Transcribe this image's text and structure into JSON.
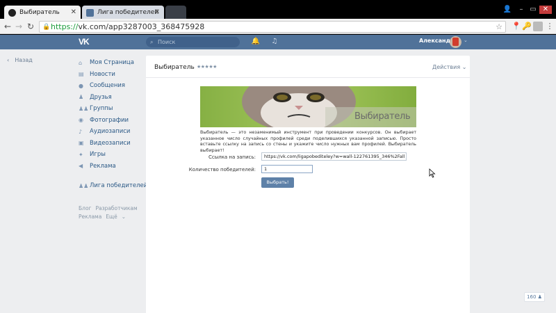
{
  "browser": {
    "tabs": [
      {
        "label": "Выбиратель",
        "active": true
      },
      {
        "label": "Лига победителей",
        "active": false
      }
    ],
    "url_scheme": "https://",
    "url_rest": "vk.com/app3287003_368475928",
    "window_controls": [
      "–",
      "▭",
      "✕"
    ]
  },
  "header": {
    "search_placeholder": "Поиск",
    "user_name": "Александр",
    "icons": [
      "bell-icon",
      "music-icon"
    ],
    "brand_color": "#507299"
  },
  "back_link": "Назад",
  "menu": {
    "items": [
      {
        "label": "Моя Страница",
        "icon": "home-icon"
      },
      {
        "label": "Новости",
        "icon": "news-icon"
      },
      {
        "label": "Сообщения",
        "icon": "messages-icon"
      },
      {
        "label": "Друзья",
        "icon": "friend-icon"
      },
      {
        "label": "Группы",
        "icon": "groups-icon"
      },
      {
        "label": "Фотографии",
        "icon": "photo-icon"
      },
      {
        "label": "Аудиозаписи",
        "icon": "music-icon"
      },
      {
        "label": "Видеозаписи",
        "icon": "video-icon"
      },
      {
        "label": "Игры",
        "icon": "games-icon"
      },
      {
        "label": "Реклама",
        "icon": "ads-icon"
      }
    ],
    "extra": {
      "label": "Лига победителей",
      "icon": "group-icon"
    },
    "footer": [
      "Блог",
      "Разработчикам",
      "Реклама",
      "Ещё"
    ]
  },
  "app": {
    "title": "Выбиратель",
    "rating": "★★★★★",
    "actions_label": "Действия",
    "banner_text": "Выбиратель",
    "description": "Выбиратель — это незаменимый инструмент при проведении конкурсов. Он выбирает указанное число случайных профилей среди поделившихся указанной записью. Просто вставьте ссылку на запись со стены и укажите число нужных вам профилей. Выбиратель выбирает!",
    "form": {
      "link_label": "Ссылка на запись:",
      "link_value": "https://vk.com/ligapobediteley?w=wall-122761395_346%2Fall",
      "count_label": "Количество победителей:",
      "count_value": "1",
      "submit_label": "Выбрать!"
    }
  },
  "online_count": "160"
}
